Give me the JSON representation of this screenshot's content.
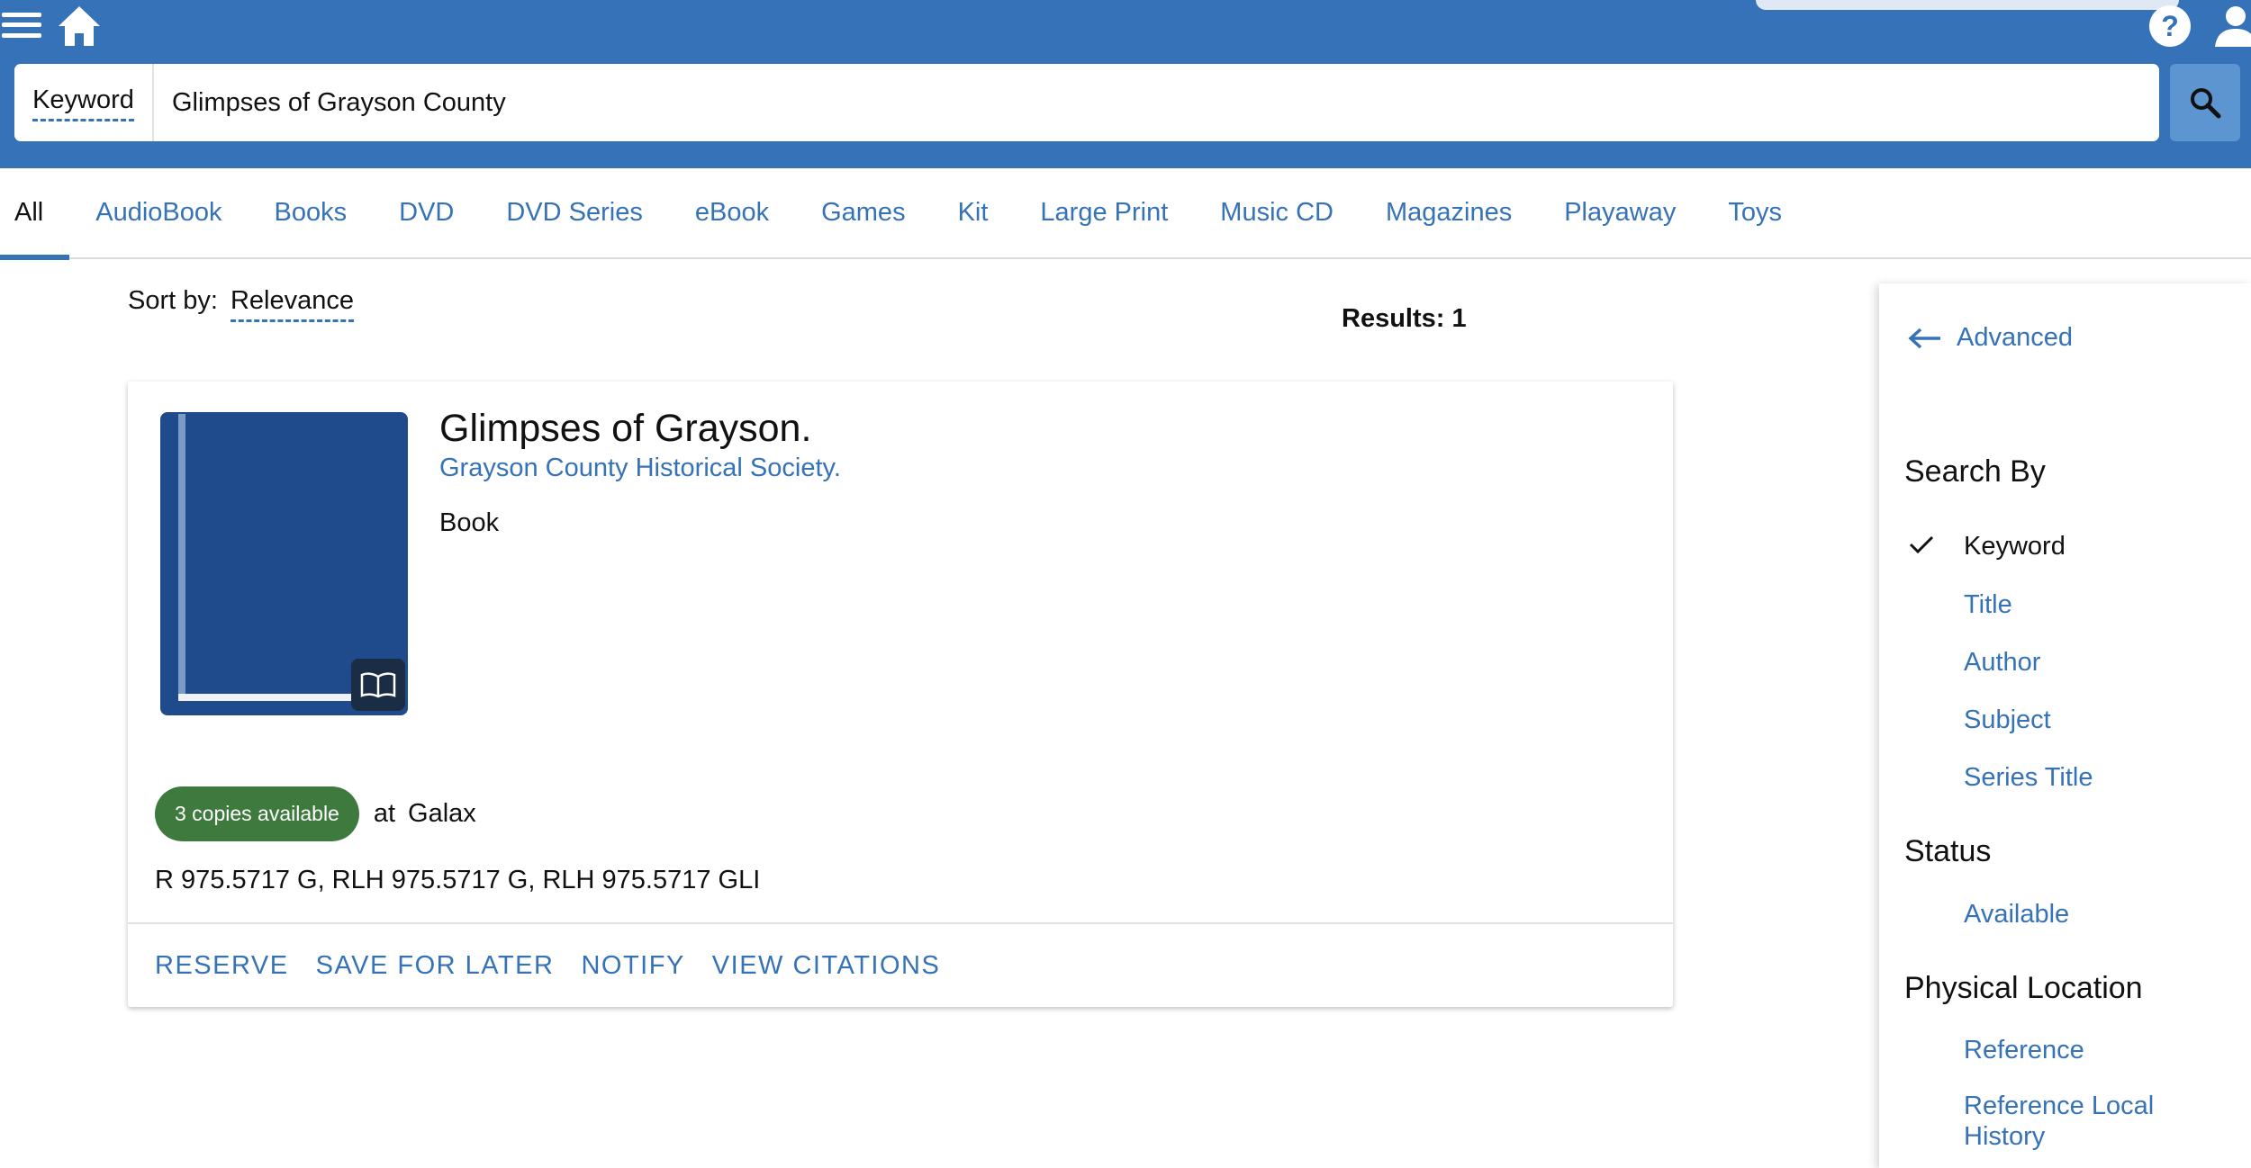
{
  "header": {
    "search_type": "Keyword",
    "search_value": "Glimpses of Grayson County"
  },
  "tabs": [
    {
      "label": "All",
      "active": true
    },
    {
      "label": "AudioBook"
    },
    {
      "label": "Books"
    },
    {
      "label": "DVD"
    },
    {
      "label": "DVD Series"
    },
    {
      "label": "eBook"
    },
    {
      "label": "Games"
    },
    {
      "label": "Kit"
    },
    {
      "label": "Large Print"
    },
    {
      "label": "Music CD"
    },
    {
      "label": "Magazines"
    },
    {
      "label": "Playaway"
    },
    {
      "label": "Toys"
    }
  ],
  "sort": {
    "label": "Sort by:",
    "value": "Relevance"
  },
  "results_label": "Results: 1",
  "result": {
    "title": "Glimpses of Grayson.",
    "author": "Grayson County Historical Society.",
    "format": "Book",
    "availability": "3 copies available",
    "at_label": "at",
    "location": "Galax",
    "call_numbers": "R 975.5717 G, RLH 975.5717 G, RLH 975.5717 GLI",
    "actions": [
      "RESERVE",
      "SAVE FOR LATER",
      "NOTIFY",
      "VIEW CITATIONS"
    ]
  },
  "panel": {
    "advanced": "Advanced",
    "search_by_heading": "Search By",
    "search_by": [
      "Keyword",
      "Title",
      "Author",
      "Subject",
      "Series Title"
    ],
    "status_heading": "Status",
    "status_options": [
      "Available"
    ],
    "location_heading": "Physical Location",
    "location_options": [
      "Reference",
      "Reference Local History"
    ]
  },
  "colors": {
    "brand": "#3572b8",
    "available": "#3e7a3d",
    "cover": "#1f4a8b"
  }
}
